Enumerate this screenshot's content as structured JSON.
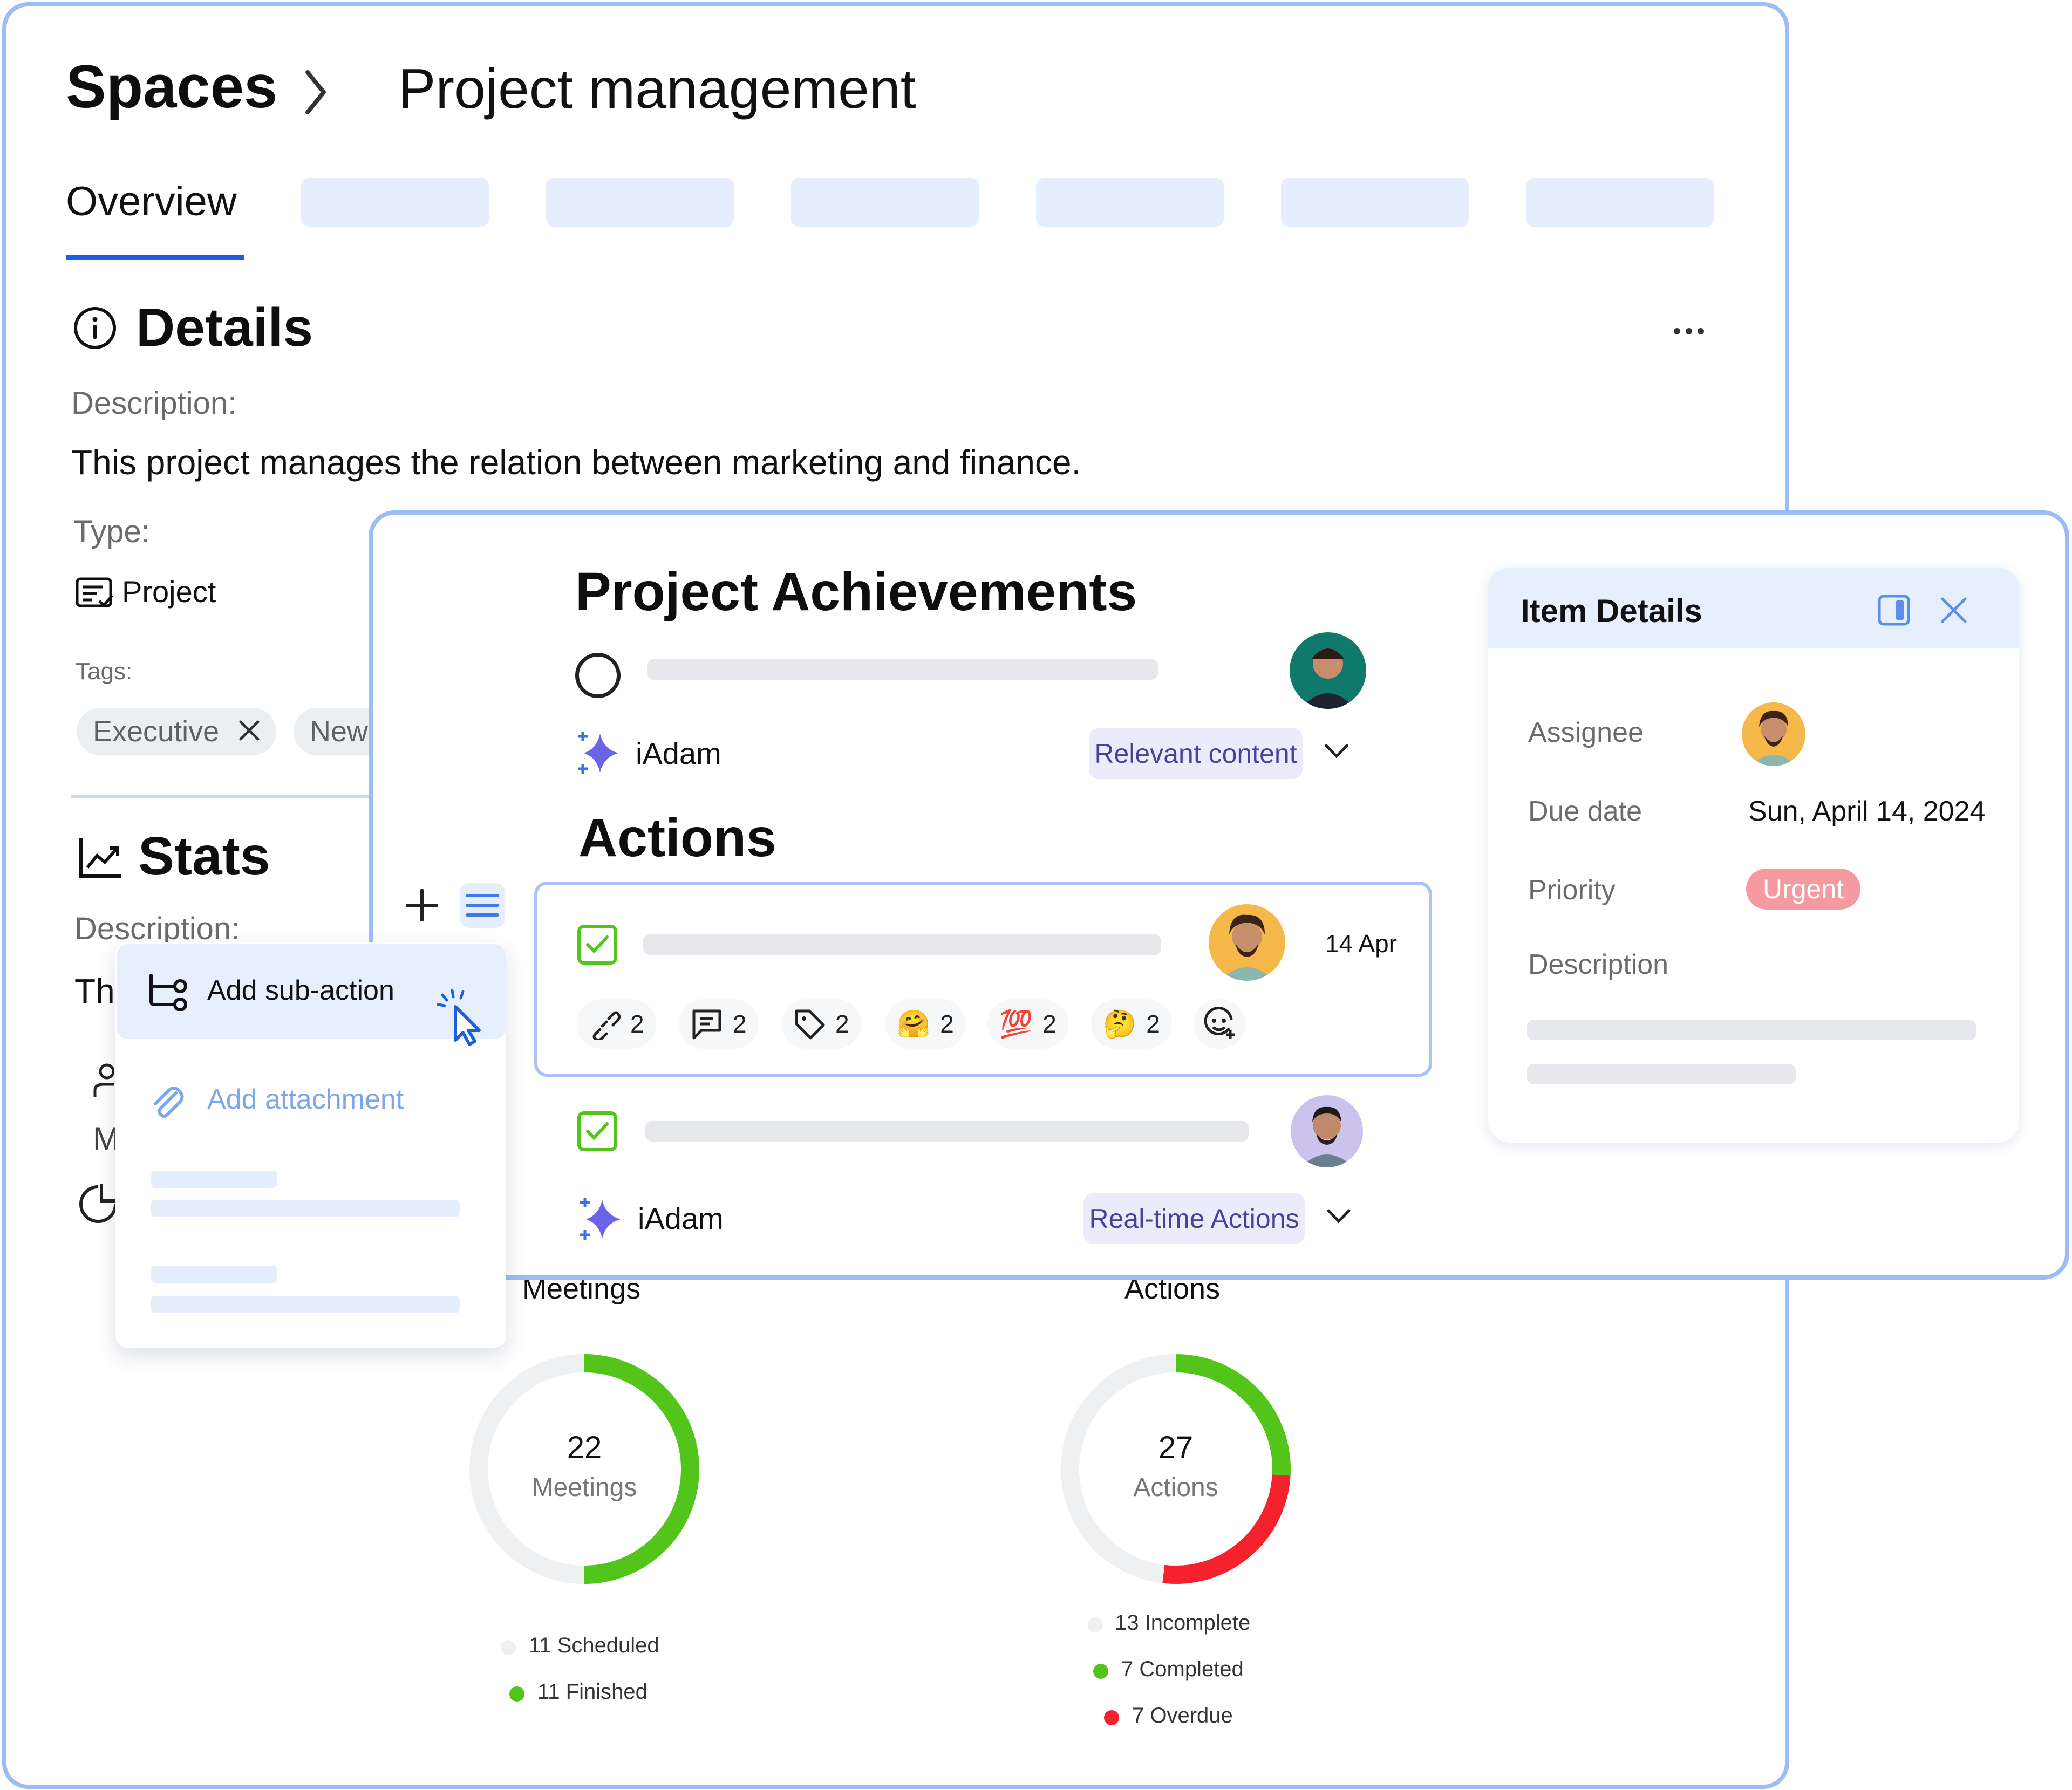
{
  "breadcrumb": {
    "root": "Spaces",
    "current": "Project management"
  },
  "tabs": {
    "active": "Overview",
    "placeholder_count": 6
  },
  "details": {
    "title": "Details",
    "description_label": "Description:",
    "description": "This project manages the relation between marketing and finance.",
    "type_label": "Type:",
    "type_value": "Project",
    "tags_label": "Tags:",
    "tags": [
      "Executive",
      "New"
    ]
  },
  "stats": {
    "title": "Stats",
    "description_label": "Description:",
    "description_partial": "Th",
    "partial_letter": "M"
  },
  "context_menu": {
    "items": [
      {
        "label": "Add sub-action",
        "icon": "branch-icon",
        "highlighted": true
      },
      {
        "label": "Add attachment",
        "icon": "paperclip-icon",
        "highlighted": false
      }
    ]
  },
  "achievements": {
    "title": "Project Achievements",
    "assistant_name": "iAdam",
    "tag": "Relevant content",
    "actions_title": "Actions",
    "actions": [
      {
        "date": "14 Apr",
        "checked": true,
        "chips": [
          {
            "icon": "link-icon",
            "count": "2"
          },
          {
            "icon": "comment-icon",
            "count": "2"
          },
          {
            "icon": "tag-icon",
            "count": "2"
          },
          {
            "icon": "hugging-face-emoji",
            "glyph": "🤗",
            "count": "2"
          },
          {
            "icon": "hundred-points-emoji",
            "glyph": "💯",
            "count": "2"
          },
          {
            "icon": "thinking-face-emoji",
            "glyph": "🤔",
            "count": "2"
          }
        ]
      },
      {
        "checked": true,
        "assistant_name": "iAdam",
        "tag": "Real-time Actions"
      }
    ]
  },
  "item_details": {
    "title": "Item Details",
    "assignee_label": "Assignee",
    "due_date_label": "Due date",
    "due_date": "Sun, April 14, 2024",
    "priority_label": "Priority",
    "priority": "Urgent",
    "description_label": "Description"
  },
  "colors": {
    "accent": "#1a5fe0",
    "border": "#9dbcf7",
    "green": "#52c41a",
    "red": "#f5222d",
    "urgent": "#f59ba0",
    "track": "#eef0f1"
  },
  "chart_data": [
    {
      "type": "pie",
      "title": "Meetings",
      "total": 22,
      "total_label": "Meetings",
      "categories": [
        "Scheduled",
        "Finished"
      ],
      "values": [
        11,
        11
      ],
      "colors": [
        "#eef0f1",
        "#52c41a"
      ],
      "legend": [
        "11 Scheduled",
        "11 Finished"
      ],
      "legend_position": "bottom"
    },
    {
      "type": "pie",
      "title": "Actions",
      "total": 27,
      "total_label": "Actions",
      "categories": [
        "Incomplete",
        "Completed",
        "Overdue"
      ],
      "values": [
        13,
        7,
        7
      ],
      "colors": [
        "#eef0f1",
        "#52c41a",
        "#f5222d"
      ],
      "legend": [
        "13 Incomplete",
        "7 Completed",
        "7 Overdue"
      ],
      "legend_position": "bottom"
    }
  ]
}
